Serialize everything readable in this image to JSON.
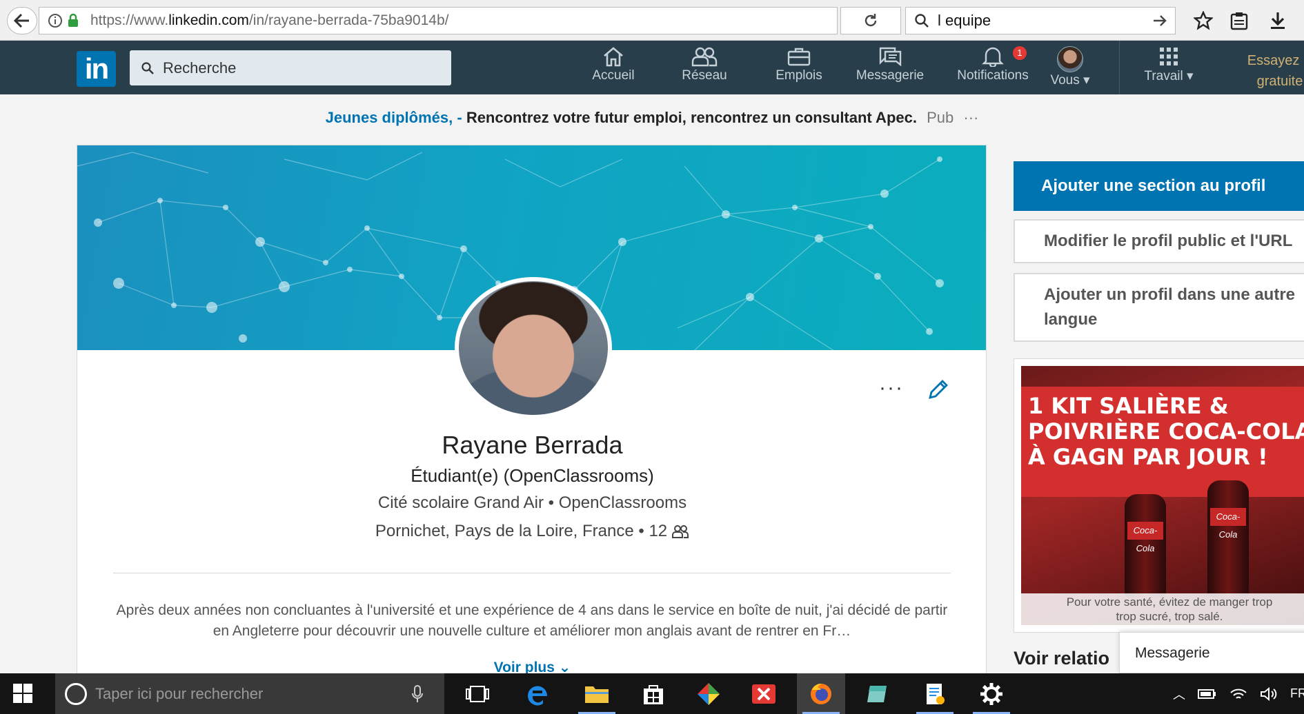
{
  "browser": {
    "url_prefix": "https://www.",
    "url_domain": "linkedin.com",
    "url_path": "/in/rayane-berrada-75ba9014b/",
    "search_value": "l equipe"
  },
  "nav": {
    "search_placeholder": "Recherche",
    "items": [
      {
        "label": "Accueil"
      },
      {
        "label": "Réseau"
      },
      {
        "label": "Emplois"
      },
      {
        "label": "Messagerie"
      },
      {
        "label": "Notifications",
        "badge": "1"
      },
      {
        "label": "Vous"
      },
      {
        "label": "Travail"
      }
    ],
    "premium_line1": "Essayez P",
    "premium_line2": "gratuite"
  },
  "ad": {
    "blue": "Jeunes diplômés, -",
    "text": "Rencontrez votre futur emploi, rencontrez un consultant Apec.",
    "pub": "Pub",
    "more": "···"
  },
  "profile": {
    "name": "Rayane Berrada",
    "headline": "Étudiant(e) (OpenClassrooms)",
    "education": "Cité scolaire Grand Air • OpenClassrooms",
    "location": "Pornichet, Pays de la Loire, France • 12",
    "summary": "Après deux années non concluantes à l'université et une expérience de 4 ans dans le service en boîte de nuit, j'ai décidé de partir en Angleterre pour découvrir une nouvelle culture et améliorer mon anglais avant de rentrer en Fr…",
    "see_more": "Voir plus",
    "more_dots": "···"
  },
  "rail": {
    "add_section": "Ajouter une section au profil",
    "edit_public": "Modifier le profil public et l'URL",
    "add_language_1": "Ajouter un profil dans une autre",
    "add_language_2": "langue",
    "ad_title": "1 KIT SALIÈRE & POIVRIÈRE COCA-COLA À GAGN PAR JOUR !",
    "bottle_label": "Coca-Cola",
    "ad_footer_1": "Pour votre santé, évitez de manger trop",
    "ad_footer_2": "trop sucré, trop salé.",
    "voir_relations": "Voir relatio",
    "messaging": "Messagerie"
  },
  "taskbar": {
    "search_placeholder": "Taper ici pour rechercher",
    "lang": "FR"
  },
  "colors": {
    "linkedin_blue": "#0073b1",
    "nav_bg": "#283e4a",
    "premium_gold": "#d1b073",
    "notif_badge": "#e53935"
  }
}
